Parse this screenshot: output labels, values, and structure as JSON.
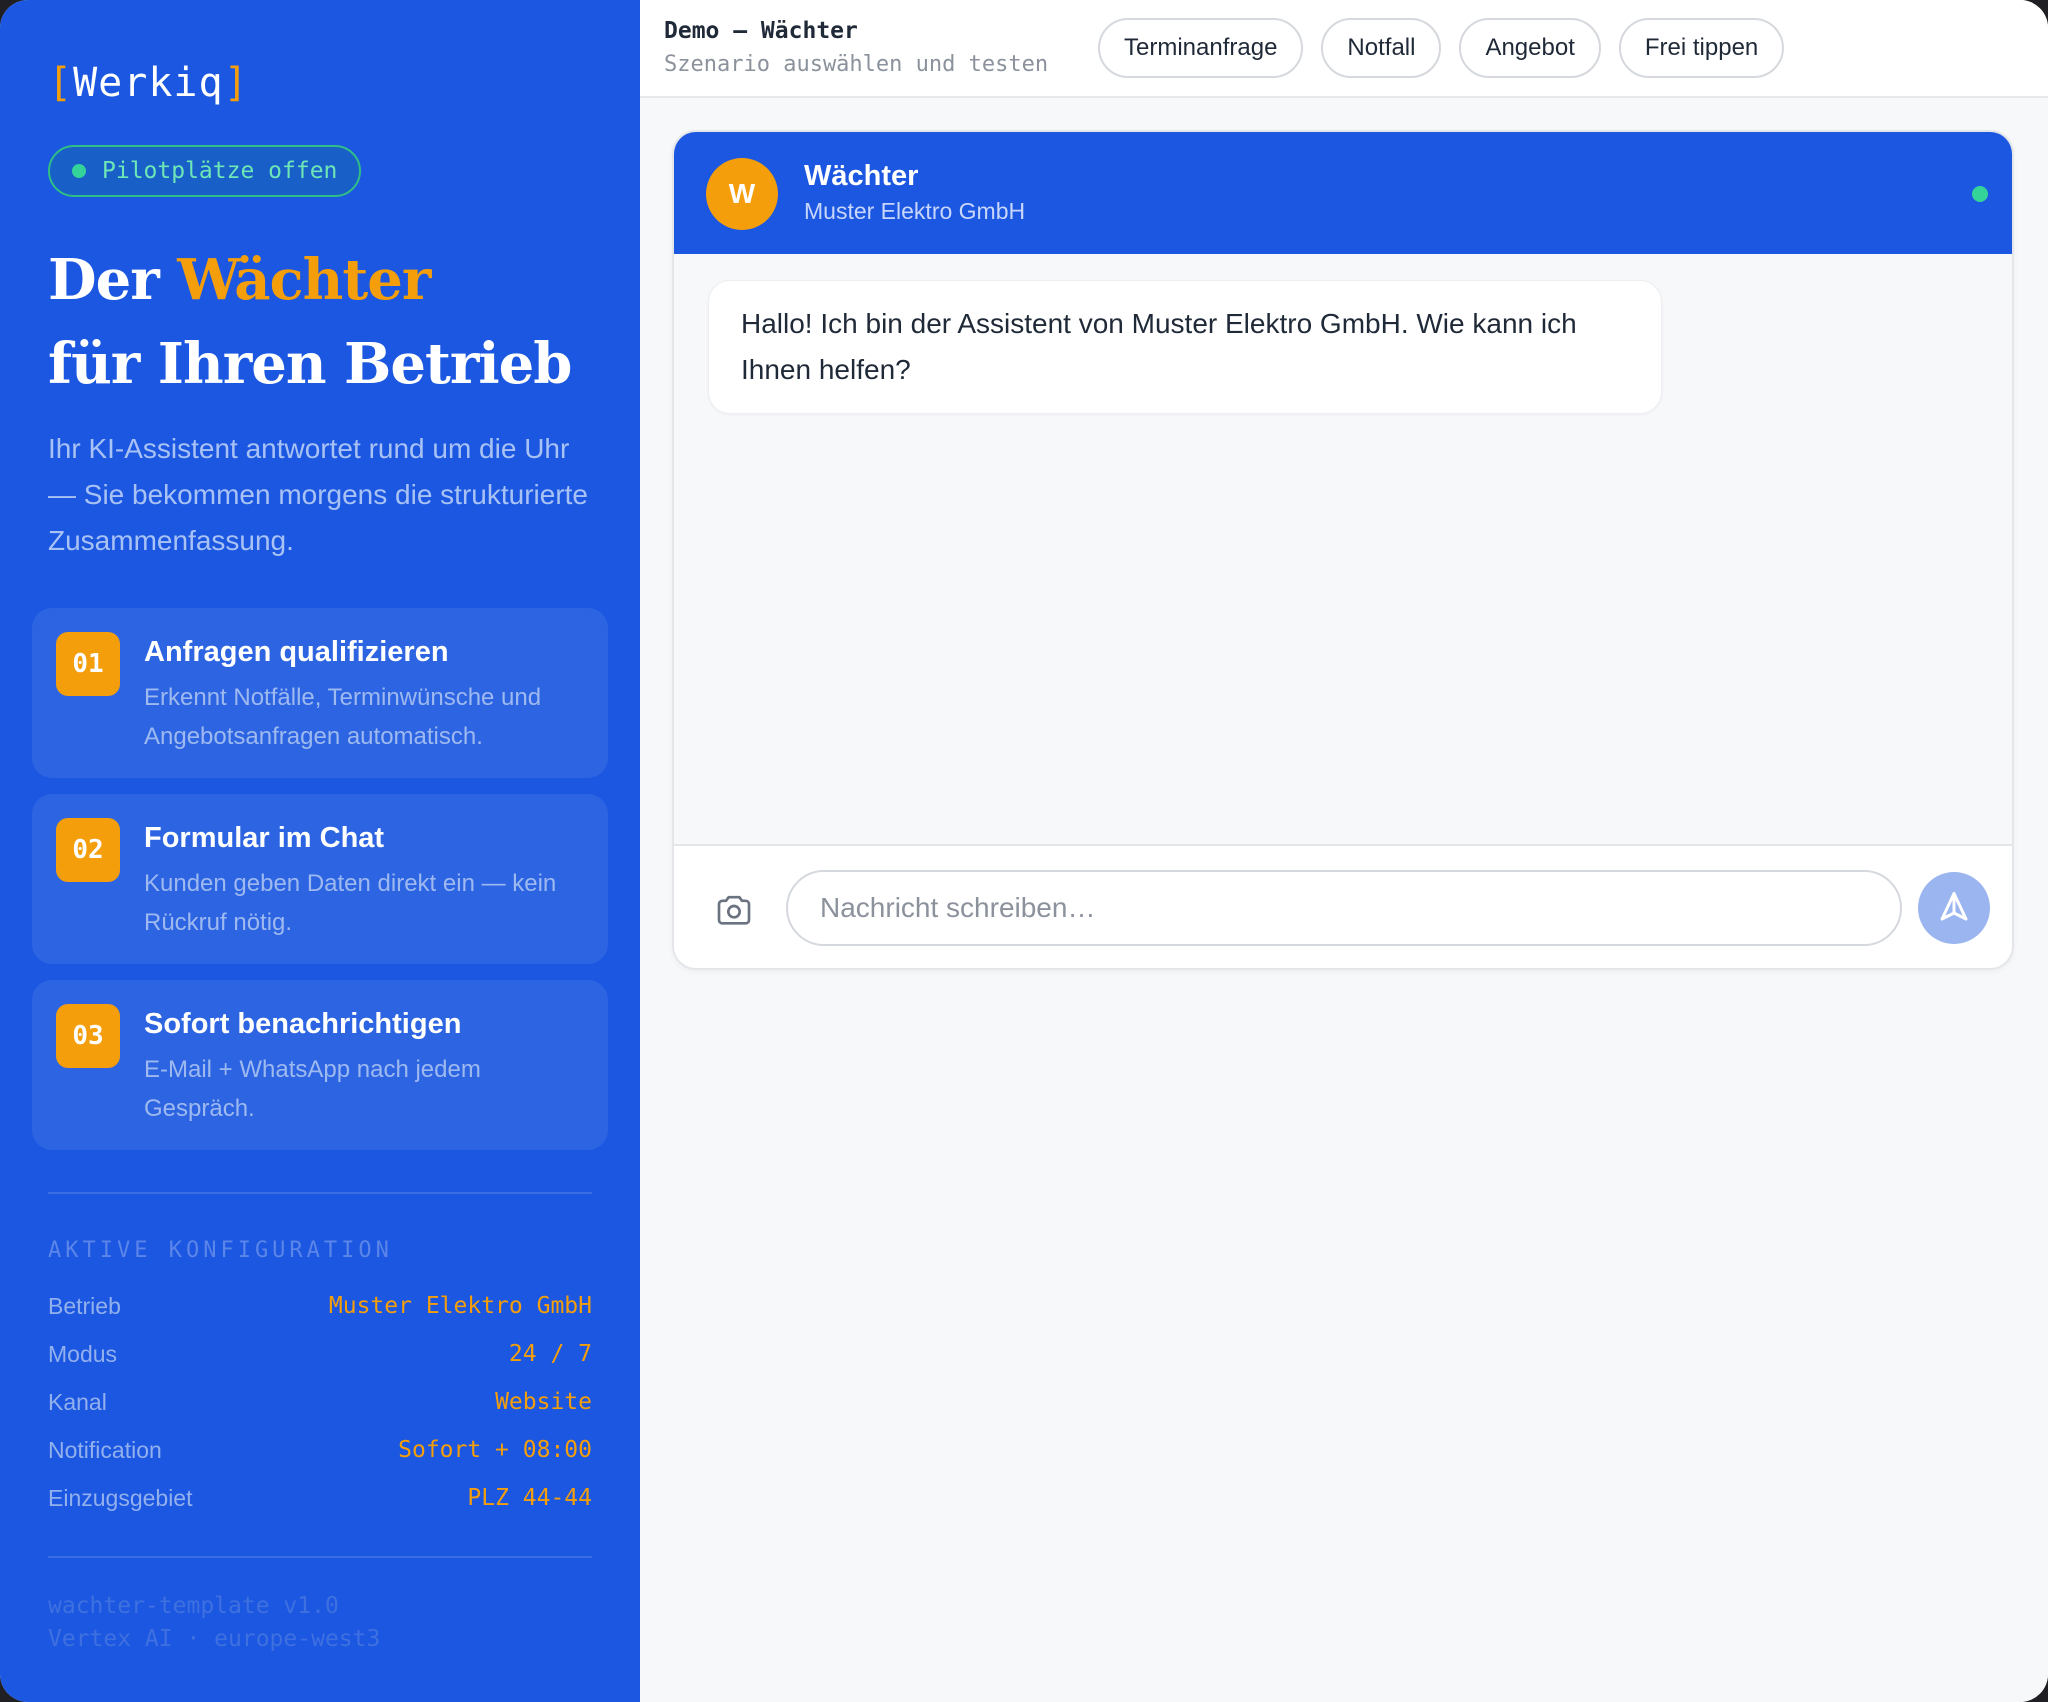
{
  "sidebar": {
    "logo": {
      "open": "[",
      "name": "Werkiq",
      "close": "]"
    },
    "badge": "Pilotplätze offen",
    "hero": {
      "word1": "Der",
      "accent": "Wächter",
      "line2": "für Ihren Betrieb"
    },
    "intro": "Ihr KI-Assistent antwortet rund um die Uhr — Sie bekommen morgens die strukturierte Zusammenfassung.",
    "features": [
      {
        "num": "01",
        "title": "Anfragen qualifizieren",
        "desc": "Erkennt Notfälle, Terminwünsche und Angebotsanfragen automatisch."
      },
      {
        "num": "02",
        "title": "Formular im Chat",
        "desc": "Kunden geben Daten direkt ein — kein Rückruf nötig."
      },
      {
        "num": "03",
        "title": "Sofort benachrichtigen",
        "desc": "E-Mail + WhatsApp nach jedem Gespräch."
      }
    ],
    "config_title": "AKTIVE KONFIGURATION",
    "config": [
      {
        "key": "Betrieb",
        "value": "Muster Elektro GmbH"
      },
      {
        "key": "Modus",
        "value": "24 / 7"
      },
      {
        "key": "Kanal",
        "value": "Website"
      },
      {
        "key": "Notification",
        "value": "Sofort + 08:00"
      },
      {
        "key": "Einzugsgebiet",
        "value": "PLZ 44-44"
      }
    ],
    "footer": {
      "line1": "wachter-template v1.0",
      "line2": "Vertex AI · europe-west3"
    }
  },
  "topbar": {
    "title": "Demo — Wächter",
    "subtitle": "Szenario auswählen und testen",
    "chips": [
      "Terminanfrage",
      "Notfall",
      "Angebot",
      "Frei tippen"
    ]
  },
  "chat": {
    "avatar_letter": "W",
    "name": "Wächter",
    "company": "Muster Elektro GmbH",
    "messages": [
      {
        "from": "bot",
        "text": "Hallo! Ich bin der Assistent von Muster Elektro GmbH. Wie kann ich Ihnen helfen?"
      }
    ],
    "input_placeholder": "Nachricht schreiben…",
    "icons": {
      "attach": "camera-icon",
      "send": "send-icon"
    }
  },
  "colors": {
    "brand": "#1b57e0",
    "accent": "#f59e0b",
    "online": "#34d399"
  }
}
